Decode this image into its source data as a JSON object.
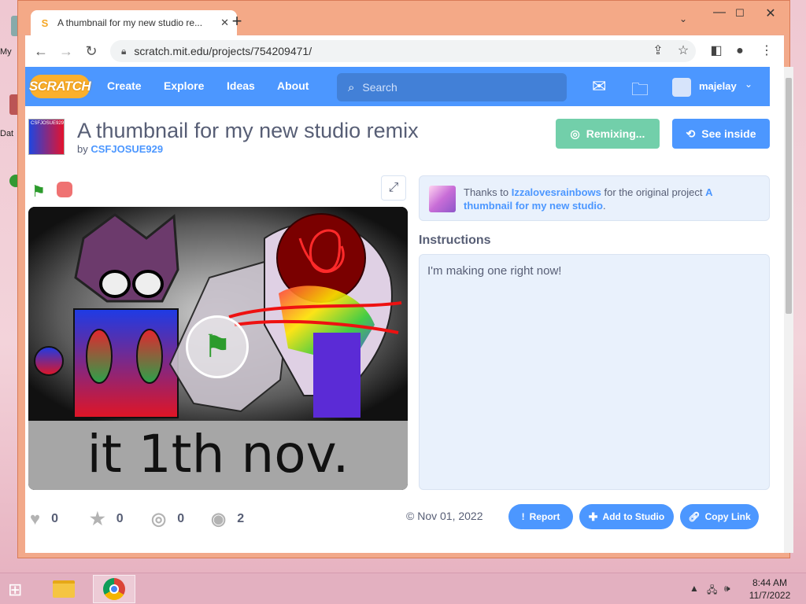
{
  "browser": {
    "tab_title": "A thumbnail for my new studio re...",
    "tab_favicon": "S",
    "url": "scratch.mit.edu/projects/754209471/"
  },
  "scratch_nav": {
    "logo": "SCRATCH",
    "links": [
      "Create",
      "Explore",
      "Ideas",
      "About"
    ],
    "search_placeholder": "Search",
    "username": "majelay"
  },
  "project": {
    "thumb_label": "CSFJOSUE929",
    "title": "A thumbnail for my new studio remix",
    "by_label": "by",
    "author": "CSFJOSUE929",
    "remix_button": "Remixing...",
    "see_inside_button": "See inside",
    "stage_text": "it 1th nov.",
    "thanks_prefix": "Thanks to",
    "thanks_user": "Izzalovesrainbows",
    "thanks_middle": "for the original project",
    "thanks_project": "A thumbnail for my new studio",
    "thanks_suffix": ".",
    "instructions_heading": "Instructions",
    "instructions_text": "I'm making one right now!",
    "stats": {
      "loves": "0",
      "favorites": "0",
      "remixes": "0",
      "views": "2"
    },
    "date": "© Nov 01, 2022",
    "buttons": {
      "report": "Report",
      "add_to_studio": "Add to Studio",
      "copy_link": "Copy Link"
    }
  },
  "desktop": {
    "icon_labels": [
      "My",
      "Dat"
    ]
  },
  "taskbar": {
    "time": "8:44 AM",
    "date": "11/7/2022"
  },
  "colors": {
    "scratch_blue": "#4c97ff",
    "remix_green": "#72cfaa",
    "text_gray": "#575e75",
    "window_frame": "#f2a98a"
  }
}
